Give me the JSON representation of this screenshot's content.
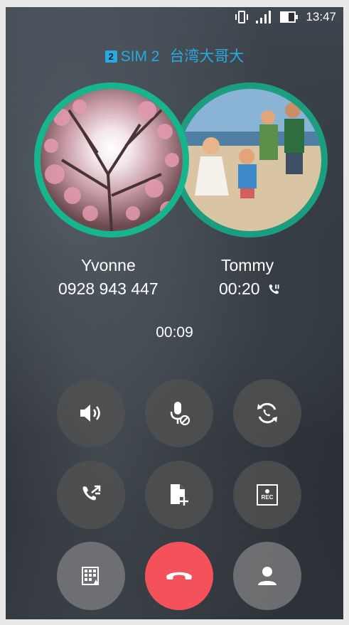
{
  "status_bar": {
    "time": "13:47",
    "icons": [
      "vibrate-icon",
      "signal-icon",
      "battery-icon"
    ]
  },
  "sim": {
    "badge": "2",
    "label": "SIM 2",
    "carrier": "台湾大哥大",
    "color": "#27a9e1"
  },
  "callers": [
    {
      "name": "Yvonne",
      "detail": "0928 943 447"
    },
    {
      "name": "Tommy",
      "detail": "00:20",
      "status_icon": "call-hold-icon"
    }
  ],
  "call_timer": "00:09",
  "buttons": [
    {
      "name": "speaker-button",
      "icon": "speaker-icon"
    },
    {
      "name": "mute-button",
      "icon": "mic-off-icon"
    },
    {
      "name": "swap-call-button",
      "icon": "swap-icon"
    },
    {
      "name": "merge-call-button",
      "icon": "call-merge-icon"
    },
    {
      "name": "add-note-button",
      "icon": "note-add-icon"
    },
    {
      "name": "record-button",
      "icon": "rec-icon",
      "icon_text": "REC"
    },
    {
      "name": "dialpad-button",
      "icon": "dialpad-icon"
    },
    {
      "name": "end-call-button",
      "icon": "hangup-icon",
      "color": "#f4525a"
    },
    {
      "name": "contacts-button",
      "icon": "person-icon"
    }
  ],
  "colors": {
    "avatar_ring": "#16b58e",
    "end_call": "#f4525a"
  }
}
